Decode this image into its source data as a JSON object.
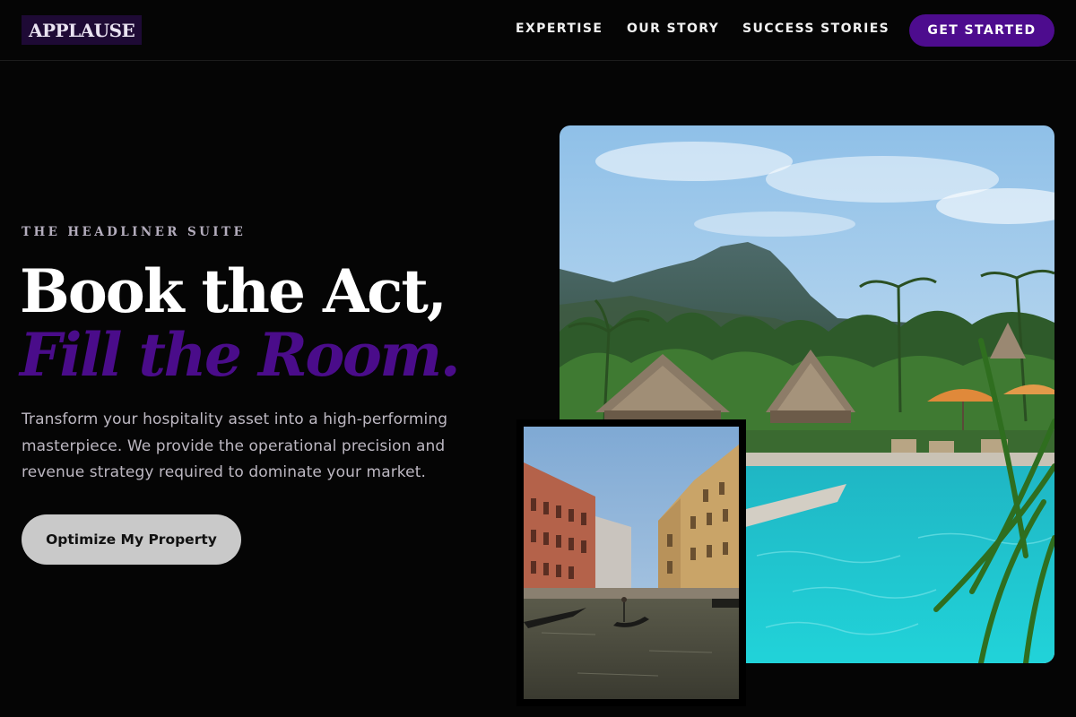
{
  "header": {
    "logo": "APPLAUSE",
    "nav": [
      {
        "label": "EXPERTISE"
      },
      {
        "label": "OUR STORY"
      },
      {
        "label": "SUCCESS STORIES"
      }
    ],
    "cta_label": "GET STARTED"
  },
  "hero": {
    "eyebrow": "THE HEADLINER SUITE",
    "headline_line1": "Book the Act,",
    "headline_line2": "Fill the Room.",
    "description": "Transform your hospitality asset into a high-performing masterpiece. We provide the operational precision and revenue strategy required to dominate your market.",
    "primary_button": "Optimize My Property"
  },
  "colors": {
    "background": "#050505",
    "accent_purple": "#4d0c8e",
    "headline_accent": "#4a0c8a",
    "button_grey": "#c9c9c9"
  },
  "images": {
    "main": "tropical-resort-pool-photo",
    "secondary": "venice-canal-gondola-photo"
  }
}
